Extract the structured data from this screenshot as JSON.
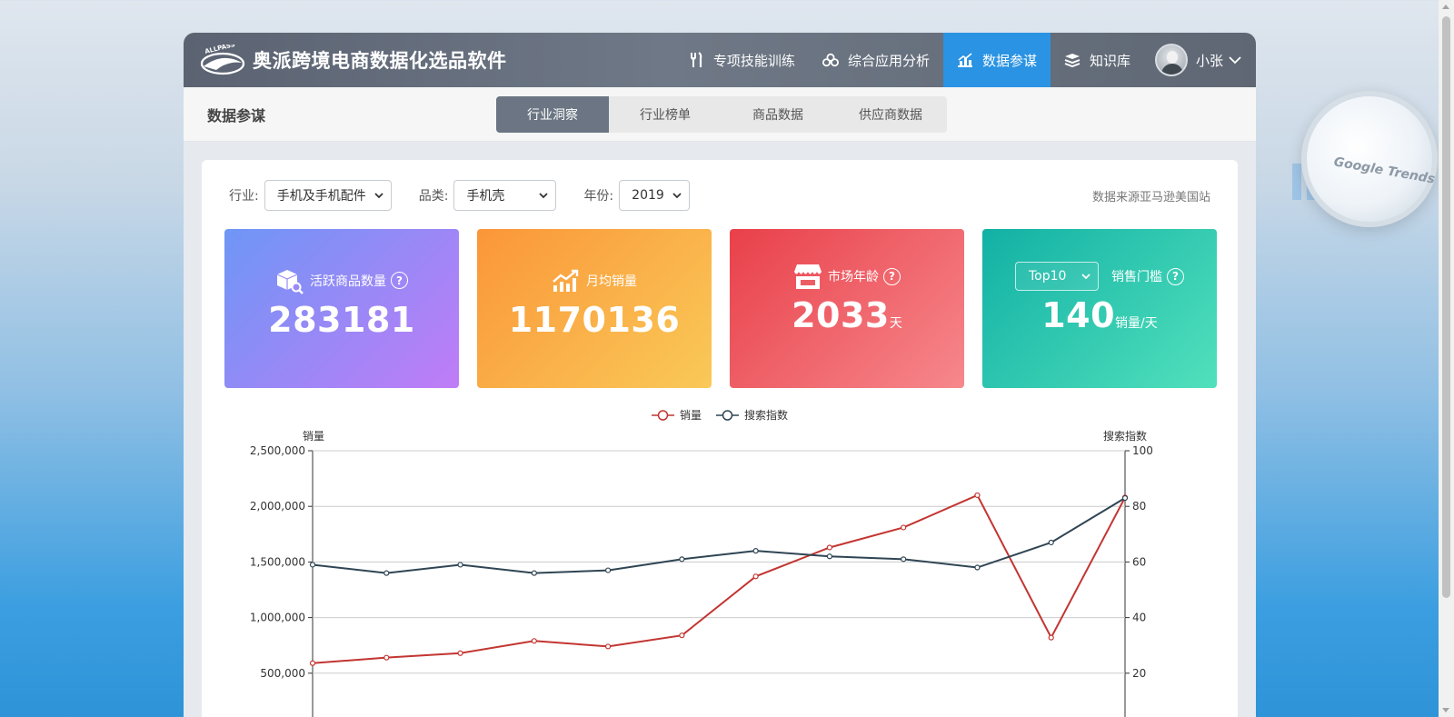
{
  "app": {
    "title": "奥派跨境电商数据化选品软件",
    "logo_text": "ALLPASS"
  },
  "nav": {
    "items": [
      {
        "label": "专项技能训练",
        "icon": "tools-icon"
      },
      {
        "label": "综合应用分析",
        "icon": "coins-icon"
      },
      {
        "label": "数据参谋",
        "icon": "bar-chart-icon",
        "active": true
      },
      {
        "label": "知识库",
        "icon": "books-icon"
      }
    ],
    "user": {
      "name": "小张"
    }
  },
  "subbar": {
    "title": "数据参谋",
    "tabs": [
      {
        "label": "行业洞察",
        "active": true
      },
      {
        "label": "行业榜单"
      },
      {
        "label": "商品数据"
      },
      {
        "label": "供应商数据"
      }
    ]
  },
  "filters": {
    "industry_label": "行业:",
    "industry_value": "手机及手机配件",
    "category_label": "品类:",
    "category_value": "手机壳",
    "year_label": "年份:",
    "year_value": "2019",
    "source_note": "数据来源亚马逊美国站"
  },
  "cards": {
    "active_products": {
      "label": "活跃商品数量",
      "value": "283181",
      "help": "?"
    },
    "monthly_sales": {
      "label": "月均销量",
      "value": "1170136"
    },
    "market_age": {
      "label": "市场年龄",
      "value": "2033",
      "unit": "天",
      "help": "?"
    },
    "sales_threshold": {
      "select_value": "Top10",
      "label": "销售门槛",
      "value": "140",
      "unit": "销量/天",
      "help": "?"
    }
  },
  "colors": {
    "accent": "#2a93e3",
    "sales_line": "#c23531",
    "search_line": "#2f4554"
  },
  "chart_data": {
    "type": "line",
    "legend": [
      "销量",
      "搜索指数"
    ],
    "y_left_label": "销量",
    "y_right_label": "搜索指数",
    "y_left_ticks": [
      "2,500,000",
      "2,000,000",
      "1,500,000",
      "1,000,000",
      "500,000"
    ],
    "y_right_ticks": [
      "100",
      "80",
      "60",
      "40",
      "20"
    ],
    "y_left_lim": [
      0,
      2500000
    ],
    "y_right_lim": [
      0,
      100
    ],
    "series": [
      {
        "name": "销量",
        "axis": "left",
        "values": [
          590000,
          640000,
          680000,
          790000,
          740000,
          840000,
          1370000,
          1630000,
          1810000,
          2100000,
          820000,
          2080000
        ]
      },
      {
        "name": "搜索指数",
        "axis": "right",
        "values": [
          59,
          56,
          59,
          56,
          57,
          61,
          64,
          62,
          61,
          58,
          67,
          83
        ]
      }
    ]
  }
}
